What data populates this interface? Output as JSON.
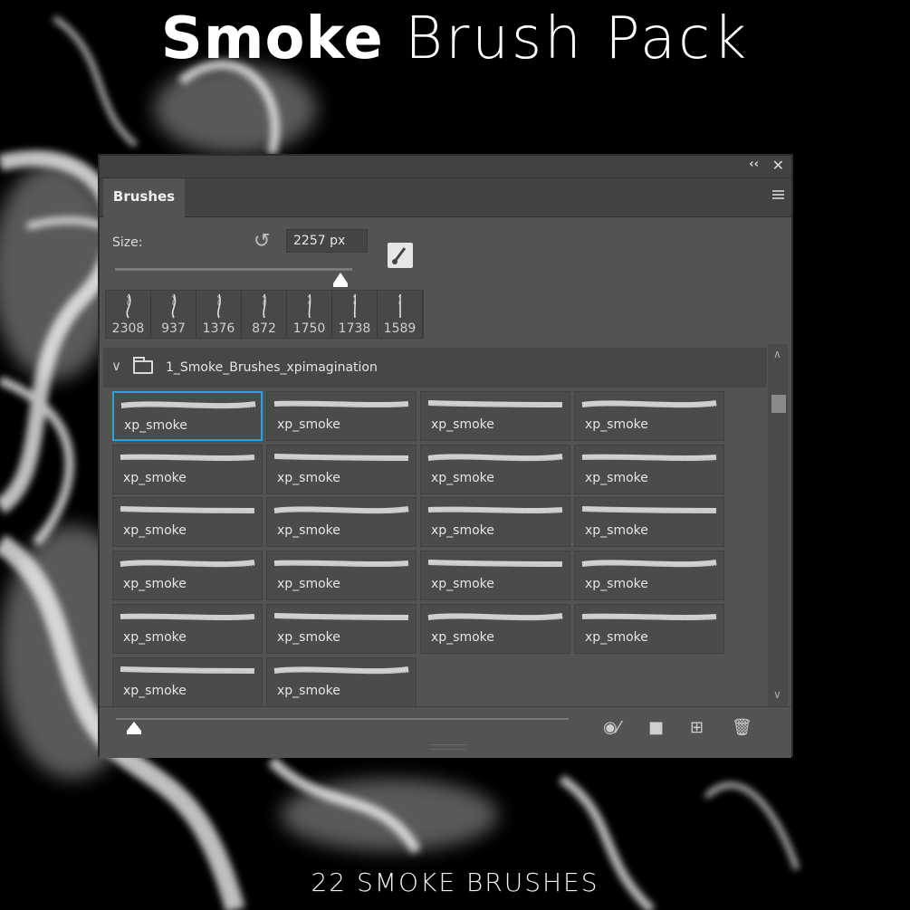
{
  "poster": {
    "title_bold": "Smoke",
    "title_light": "Brush Pack",
    "caption": "22 SMOKE BRUSHES"
  },
  "panel": {
    "collapse_icon": "double-chevron-left-icon",
    "close_icon": "close-icon",
    "tab_label": "Brushes",
    "menu_icon": "hamburger-menu-icon",
    "size_label": "Size:",
    "size_value": "2257 px",
    "size_level": 0.95,
    "recent_brushes": [
      "2308",
      "937",
      "1376",
      "872",
      "1750",
      "1738",
      "1589"
    ],
    "group_name": "1_Smoke_Brushes_xpimagination",
    "brushes": [
      "xp_smoke",
      "xp_smoke",
      "xp_smoke",
      "xp_smoke",
      "xp_smoke",
      "xp_smoke",
      "xp_smoke",
      "xp_smoke",
      "xp_smoke",
      "xp_smoke",
      "xp_smoke",
      "xp_smoke",
      "xp_smoke",
      "xp_smoke",
      "xp_smoke",
      "xp_smoke",
      "xp_smoke",
      "xp_smoke",
      "xp_smoke",
      "xp_smoke",
      "xp_smoke",
      "xp_smoke"
    ],
    "selected_index": 0,
    "footer_icons": [
      "visibility-brush-icon",
      "folder-icon",
      "new-brush-icon",
      "trash-icon"
    ],
    "accent_color": "#2aa3d6"
  }
}
